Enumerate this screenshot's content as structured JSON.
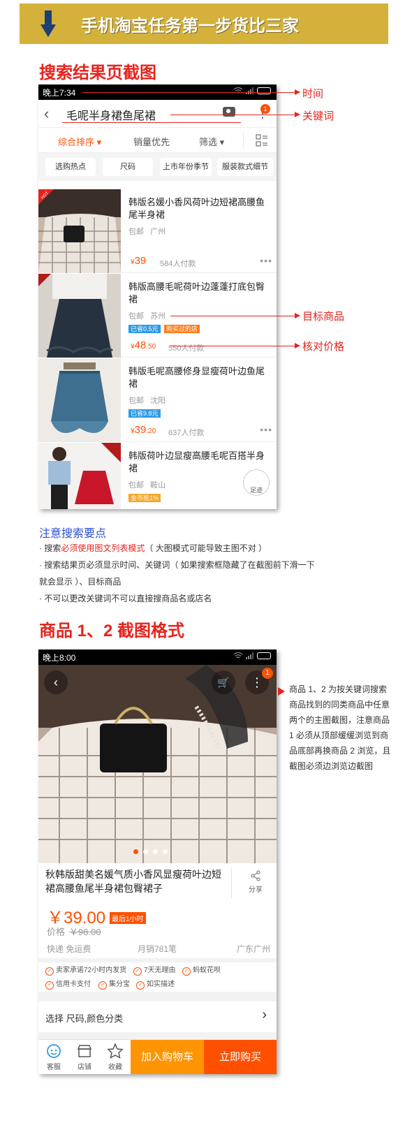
{
  "header": {
    "title": "手机淘宝任务第一步货比三家",
    "accent": "#d4b13a"
  },
  "section1": {
    "title": "搜索结果页截图"
  },
  "phone1": {
    "time": "晚上7:34",
    "keyword": "毛呢半身裙鱼尾裙",
    "notif_count": "1",
    "sort_tabs": [
      "综合排序",
      "销量优先",
      "筛选"
    ],
    "chips": [
      "选购热点",
      "尺码",
      "上市年份季节",
      "服装款式细节"
    ],
    "items": [
      {
        "title": "韩版名媛小香风荷叶边短裙高腰鱼尾半身裙",
        "ship": "包邮",
        "city": "广州",
        "price": "39",
        "price_dec": "",
        "sold": "584人付款",
        "tag1": "",
        "tag2": "",
        "badge": "HOT"
      },
      {
        "title": "韩版高腰毛呢荷叶边蓬蓬打底包臀裙",
        "ship": "包邮",
        "city": "苏州",
        "price": "48",
        "price_dec": ".50",
        "sold": "550人付款",
        "tag1": "已省0.5元",
        "tag2": "购买过的店",
        "badge": ""
      },
      {
        "title": "韩版毛呢高腰修身显瘦荷叶边鱼尾裙",
        "ship": "包邮",
        "city": "沈阳",
        "price": "39",
        "price_dec": ".20",
        "sold": "637人付款",
        "tag1": "已省9.8元",
        "tag2": "",
        "badge": ""
      },
      {
        "title": "韩版荷叶边显瘦高腰毛呢百搭半身裙",
        "ship": "包邮",
        "city": "鞍山",
        "price": "",
        "price_dec": "",
        "sold": "",
        "tag1": "金币抵1%",
        "tag2": "",
        "badge": "包邮"
      }
    ],
    "footprint": "足迹"
  },
  "annotations": {
    "time": "时间",
    "keyword": "关键词",
    "target": "目标商品",
    "price_check": "核对价格"
  },
  "notes": {
    "title": "注意搜索要点",
    "line1_pre": "· 搜索",
    "line1_hl": "必须使用图文列表模式",
    "line1_post": "（ 大图模式可能导致主图不对 ）",
    "line2": "· 搜索结果页必须显示时间、关键词（ 如果搜索框隐藏了在截图前下滑一下",
    "line3": "就会显示 ）、目标商品",
    "line4": "· 不可以更改关键词不可以直接搜商品名或店名"
  },
  "section2": {
    "title": "商品 1、2 截图格式"
  },
  "phone2": {
    "time": "晚上8:00",
    "notif_count": "1",
    "title": "秋韩版甜美名媛气质小香风显瘦荷叶边短裙高腰鱼尾半身裙包臀裙子",
    "share": "分享",
    "price": "￥39.00",
    "promo": "最后1小时",
    "old_label": "价格",
    "old_price": "￥98.00",
    "ship": "快递 免运费",
    "monthly": "月销781笔",
    "location": "广东广州",
    "services": [
      "卖家承诺72小时内发货",
      "7天无理由",
      "蚂蚁花呗",
      "信用卡支付",
      "集分宝",
      "如实描述"
    ],
    "select": "选择 尺码,颜色分类",
    "bottom": [
      "客服",
      "店铺",
      "收藏"
    ],
    "cart": "加入购物车",
    "buy": "立即购买"
  },
  "side_note": "商品 1、2 为按关键词搜索商品找到的同类商品中任意两个的主图截图，注意商品 1 必须从顶部缓缓浏览到商品底部再换商品 2 浏览，且截图必须边浏览边截图"
}
